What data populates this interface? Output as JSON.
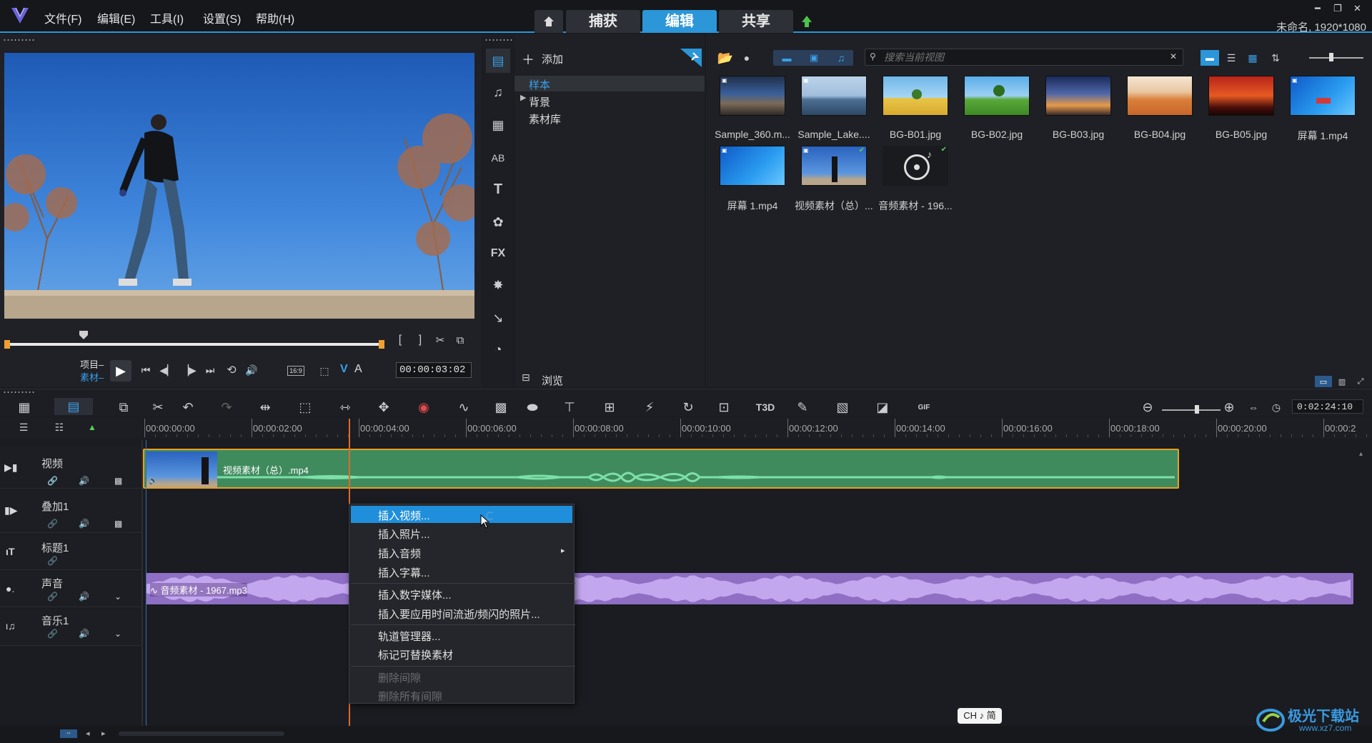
{
  "menubar": {
    "items": [
      "文件(F)",
      "编辑(E)",
      "工具(I)",
      "设置(S)",
      "帮助(H)"
    ],
    "tabs": [
      "捕获",
      "编辑",
      "共享"
    ],
    "active_tab": "编辑",
    "project": "未命名, 1920*1080"
  },
  "player": {
    "project_label": "项目",
    "clip_label": "素材",
    "timecode": "00:00:03:02",
    "aspect": "16:9",
    "v_label": "V",
    "a_label": "A"
  },
  "library": {
    "add_label": "添加",
    "folders": [
      "样本",
      "背景",
      "素材库"
    ],
    "browse_label": "浏览",
    "search_placeholder": "搜索当前视图",
    "items": [
      {
        "name": "Sample_360.m...",
        "kind": "video"
      },
      {
        "name": "Sample_Lake....",
        "kind": "video"
      },
      {
        "name": "BG-B01.jpg",
        "kind": "image"
      },
      {
        "name": "BG-B02.jpg",
        "kind": "image"
      },
      {
        "name": "BG-B03.jpg",
        "kind": "image"
      },
      {
        "name": "BG-B04.jpg",
        "kind": "image"
      },
      {
        "name": "BG-B05.jpg",
        "kind": "image"
      },
      {
        "name": "屏幕 1.mp4",
        "kind": "video"
      },
      {
        "name": "屏幕 1.mp4",
        "kind": "video"
      },
      {
        "name": "视频素材（总）....",
        "kind": "video"
      },
      {
        "name": "音频素材 - 196...",
        "kind": "audio"
      }
    ]
  },
  "timeline": {
    "duration": "0:02:24:10",
    "ruler": [
      "00:00:00:00",
      "00:00:02:00",
      "00:00:04:00",
      "00:00:06:00",
      "00:00:08:00",
      "00:00:10:00",
      "00:00:12:00",
      "00:00:14:00",
      "00:00:16:00",
      "00:00:18:00",
      "00:00:20:00",
      "00:00:2"
    ],
    "tracks": [
      "视频",
      "叠加1",
      "标题1",
      "声音",
      "音乐1"
    ],
    "video_clip": "视频素材（总）.mp4",
    "audio_clip": "音频素材 - 1967.mp3"
  },
  "context_menu": {
    "items": [
      {
        "label": "插入视频...",
        "enabled": true,
        "highlighted": true
      },
      {
        "label": "插入照片...",
        "enabled": true
      },
      {
        "label": "插入音频",
        "enabled": true,
        "submenu": true
      },
      {
        "label": "插入字幕...",
        "enabled": true
      },
      {
        "label": "插入数字媒体...",
        "enabled": true
      },
      {
        "label": "插入要应用时间流逝/频闪的照片...",
        "enabled": true
      },
      {
        "label": "轨道管理器...",
        "enabled": true
      },
      {
        "label": "标记可替换素材",
        "enabled": true
      },
      {
        "label": "删除间隙",
        "enabled": false
      },
      {
        "label": "删除所有间隙",
        "enabled": false
      }
    ]
  },
  "ime": "CH ♪ 简",
  "watermark": {
    "cn": "极光下载站",
    "url": "www.xz7.com"
  },
  "colors": {
    "accent": "#2b96d8",
    "video_clip": "#3f8b5e",
    "audio_clip": "#8f6fc4",
    "playhead": "#e06a2a"
  }
}
